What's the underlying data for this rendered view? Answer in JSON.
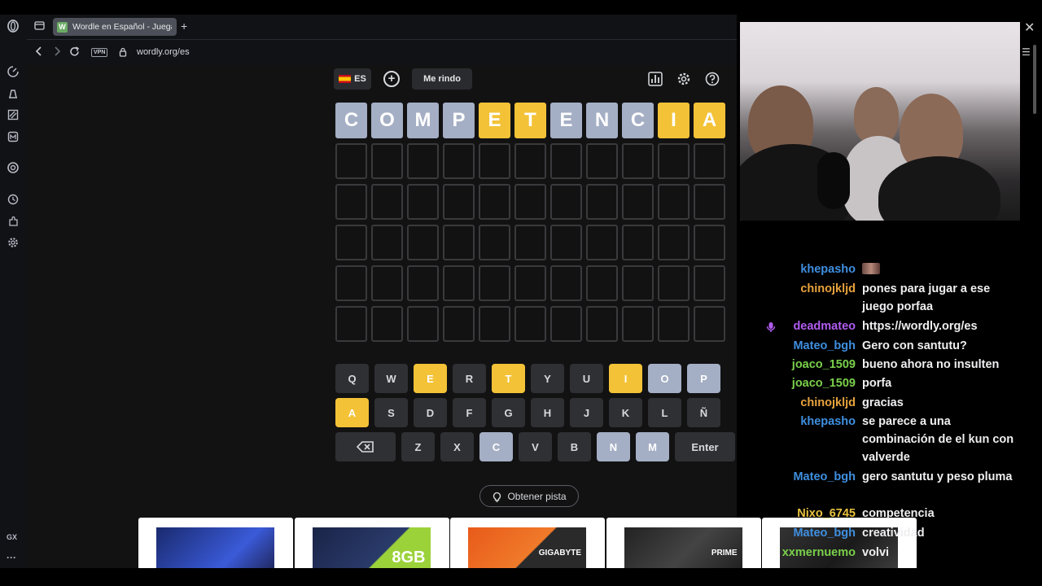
{
  "browser": {
    "tab_title": "Wordle en Español - Juega",
    "tab_favicon": "W",
    "url": "wordly.org/es",
    "vpn_label": "VPN",
    "sidebar_label": "GX"
  },
  "game": {
    "lang_label": "ES",
    "giveup_label": "Me rindo",
    "hint_label": "Obtener pista",
    "board": [
      [
        {
          "l": "C",
          "s": "absent"
        },
        {
          "l": "O",
          "s": "absent"
        },
        {
          "l": "M",
          "s": "absent"
        },
        {
          "l": "P",
          "s": "absent"
        },
        {
          "l": "E",
          "s": "present"
        },
        {
          "l": "T",
          "s": "present"
        },
        {
          "l": "E",
          "s": "absent"
        },
        {
          "l": "N",
          "s": "absent"
        },
        {
          "l": "C",
          "s": "absent"
        },
        {
          "l": "I",
          "s": "present"
        },
        {
          "l": "A",
          "s": "present"
        }
      ]
    ],
    "board_rows": 6,
    "board_cols": 11,
    "keyboard": [
      [
        {
          "k": "Q"
        },
        {
          "k": "W"
        },
        {
          "k": "E",
          "s": "present"
        },
        {
          "k": "R"
        },
        {
          "k": "T",
          "s": "present"
        },
        {
          "k": "Y"
        },
        {
          "k": "U"
        },
        {
          "k": "I",
          "s": "present"
        },
        {
          "k": "O",
          "s": "absent"
        },
        {
          "k": "P",
          "s": "absent"
        }
      ],
      [
        {
          "k": "A",
          "s": "present"
        },
        {
          "k": "S"
        },
        {
          "k": "D"
        },
        {
          "k": "F"
        },
        {
          "k": "G"
        },
        {
          "k": "H"
        },
        {
          "k": "J"
        },
        {
          "k": "K"
        },
        {
          "k": "L"
        },
        {
          "k": "Ñ"
        }
      ],
      [
        {
          "k": "⌫",
          "wide": true
        },
        {
          "k": "Z"
        },
        {
          "k": "X"
        },
        {
          "k": "C",
          "s": "absent"
        },
        {
          "k": "V"
        },
        {
          "k": "B"
        },
        {
          "k": "N",
          "s": "absent"
        },
        {
          "k": "M",
          "s": "absent"
        },
        {
          "k": "Enter",
          "wide": true
        }
      ]
    ]
  },
  "ads": {
    "items": [
      "",
      "8GB",
      "GIGABYTE",
      "PRIME",
      ""
    ]
  },
  "chat": {
    "messages": [
      {
        "user": "khepasho",
        "color": "#3f8fe0",
        "text": ""
      },
      {
        "user": "chinojkljd",
        "color": "#e8a33d",
        "text": "pones para jugar a ese juego porfaa"
      },
      {
        "user": "deadmateo",
        "color": "#b05cf0",
        "text": "https://wordly.org/es"
      },
      {
        "user": "Mateo_bgh",
        "color": "#3f8fe0",
        "text": "Gero con santutu?"
      },
      {
        "user": "joaco_1509",
        "color": "#7ad04b",
        "text": "bueno ahora no insulten"
      },
      {
        "user": "joaco_1509",
        "color": "#7ad04b",
        "text": "porfa"
      },
      {
        "user": "chinojkljd",
        "color": "#e8a33d",
        "text": "gracias"
      },
      {
        "user": "khepasho",
        "color": "#3f8fe0",
        "text": "se parece a una combinación de el kun con valverde"
      },
      {
        "user": "Mateo_bgh",
        "color": "#3f8fe0",
        "text": "gero santutu y peso pluma"
      },
      {
        "user": "Nixo_6745",
        "color": "#e8c23d",
        "text": "competencia"
      },
      {
        "user": "Mateo_bgh",
        "color": "#3f8fe0",
        "text": "creatividad"
      },
      {
        "user": "xxmernuemo",
        "color": "#7ad04b",
        "text": "volvi"
      }
    ]
  },
  "colors": {
    "present": "#f3c237",
    "absent": "#a4aec4",
    "empty_border": "#3a3a3c"
  }
}
